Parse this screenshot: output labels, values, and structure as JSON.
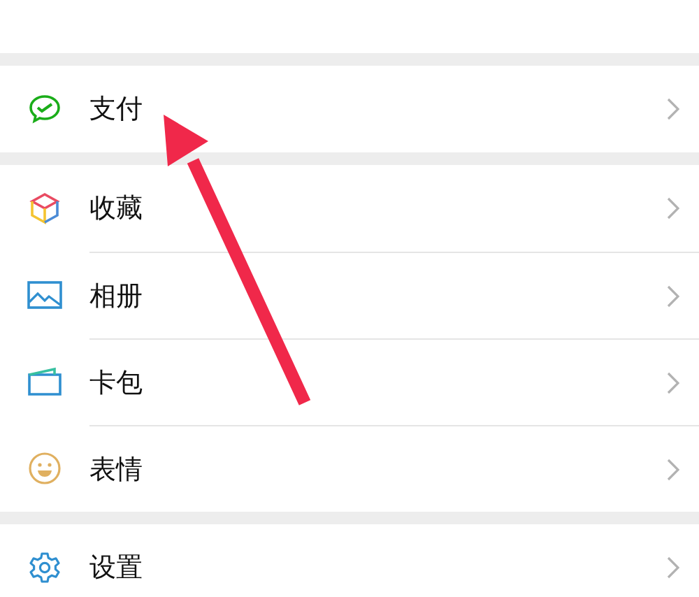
{
  "groups": [
    {
      "items": [
        {
          "label": "支付",
          "kind": "pay"
        }
      ]
    },
    {
      "items": [
        {
          "label": "收藏",
          "kind": "favorites"
        },
        {
          "label": "相册",
          "kind": "album"
        },
        {
          "label": "卡包",
          "kind": "cards"
        },
        {
          "label": "表情",
          "kind": "stickers"
        }
      ]
    },
    {
      "items": [
        {
          "label": "设置",
          "kind": "settings"
        }
      ]
    }
  ],
  "annotation": {
    "kind": "arrow"
  }
}
